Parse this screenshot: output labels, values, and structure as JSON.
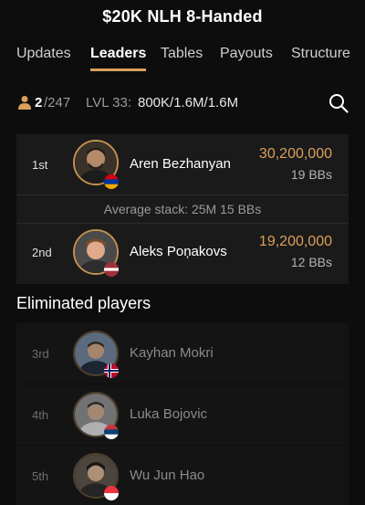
{
  "header": {
    "title": "$20K NLH 8-Handed"
  },
  "tabs": [
    {
      "label": "Updates",
      "active": false
    },
    {
      "label": "Leaders",
      "active": true
    },
    {
      "label": "Tables",
      "active": false
    },
    {
      "label": "Payouts",
      "active": false
    },
    {
      "label": "Structure",
      "active": false
    }
  ],
  "info": {
    "players_remaining": "2",
    "players_total": "/247",
    "level_label": "LVL 33:",
    "level_blinds": "800K/1.6M/1.6M"
  },
  "leaders": [
    {
      "rank": "1st",
      "name": "Aren Bezhanyan",
      "chips": "30,200,000",
      "bbs": "19 BBs",
      "flag": "armenia"
    },
    {
      "rank": "2nd",
      "name": "Aleks Poņakovs",
      "chips": "19,200,000",
      "bbs": "12 BBs",
      "flag": "latvia"
    }
  ],
  "average_stack": "Average stack: 25M 15 BBs",
  "eliminated": {
    "title": "Eliminated players",
    "players": [
      {
        "rank": "3rd",
        "name": "Kayhan Mokri",
        "flag": "norway"
      },
      {
        "rank": "4th",
        "name": "Luka Bojovic",
        "flag": "serbia"
      },
      {
        "rank": "5th",
        "name": "Wu Jun Hao",
        "flag": "singapore"
      }
    ]
  },
  "colors": {
    "accent": "#d9a05b",
    "background": "#0d0d0d",
    "card": "#1a1a1a"
  },
  "icons": [
    "person-icon",
    "search-icon"
  ]
}
